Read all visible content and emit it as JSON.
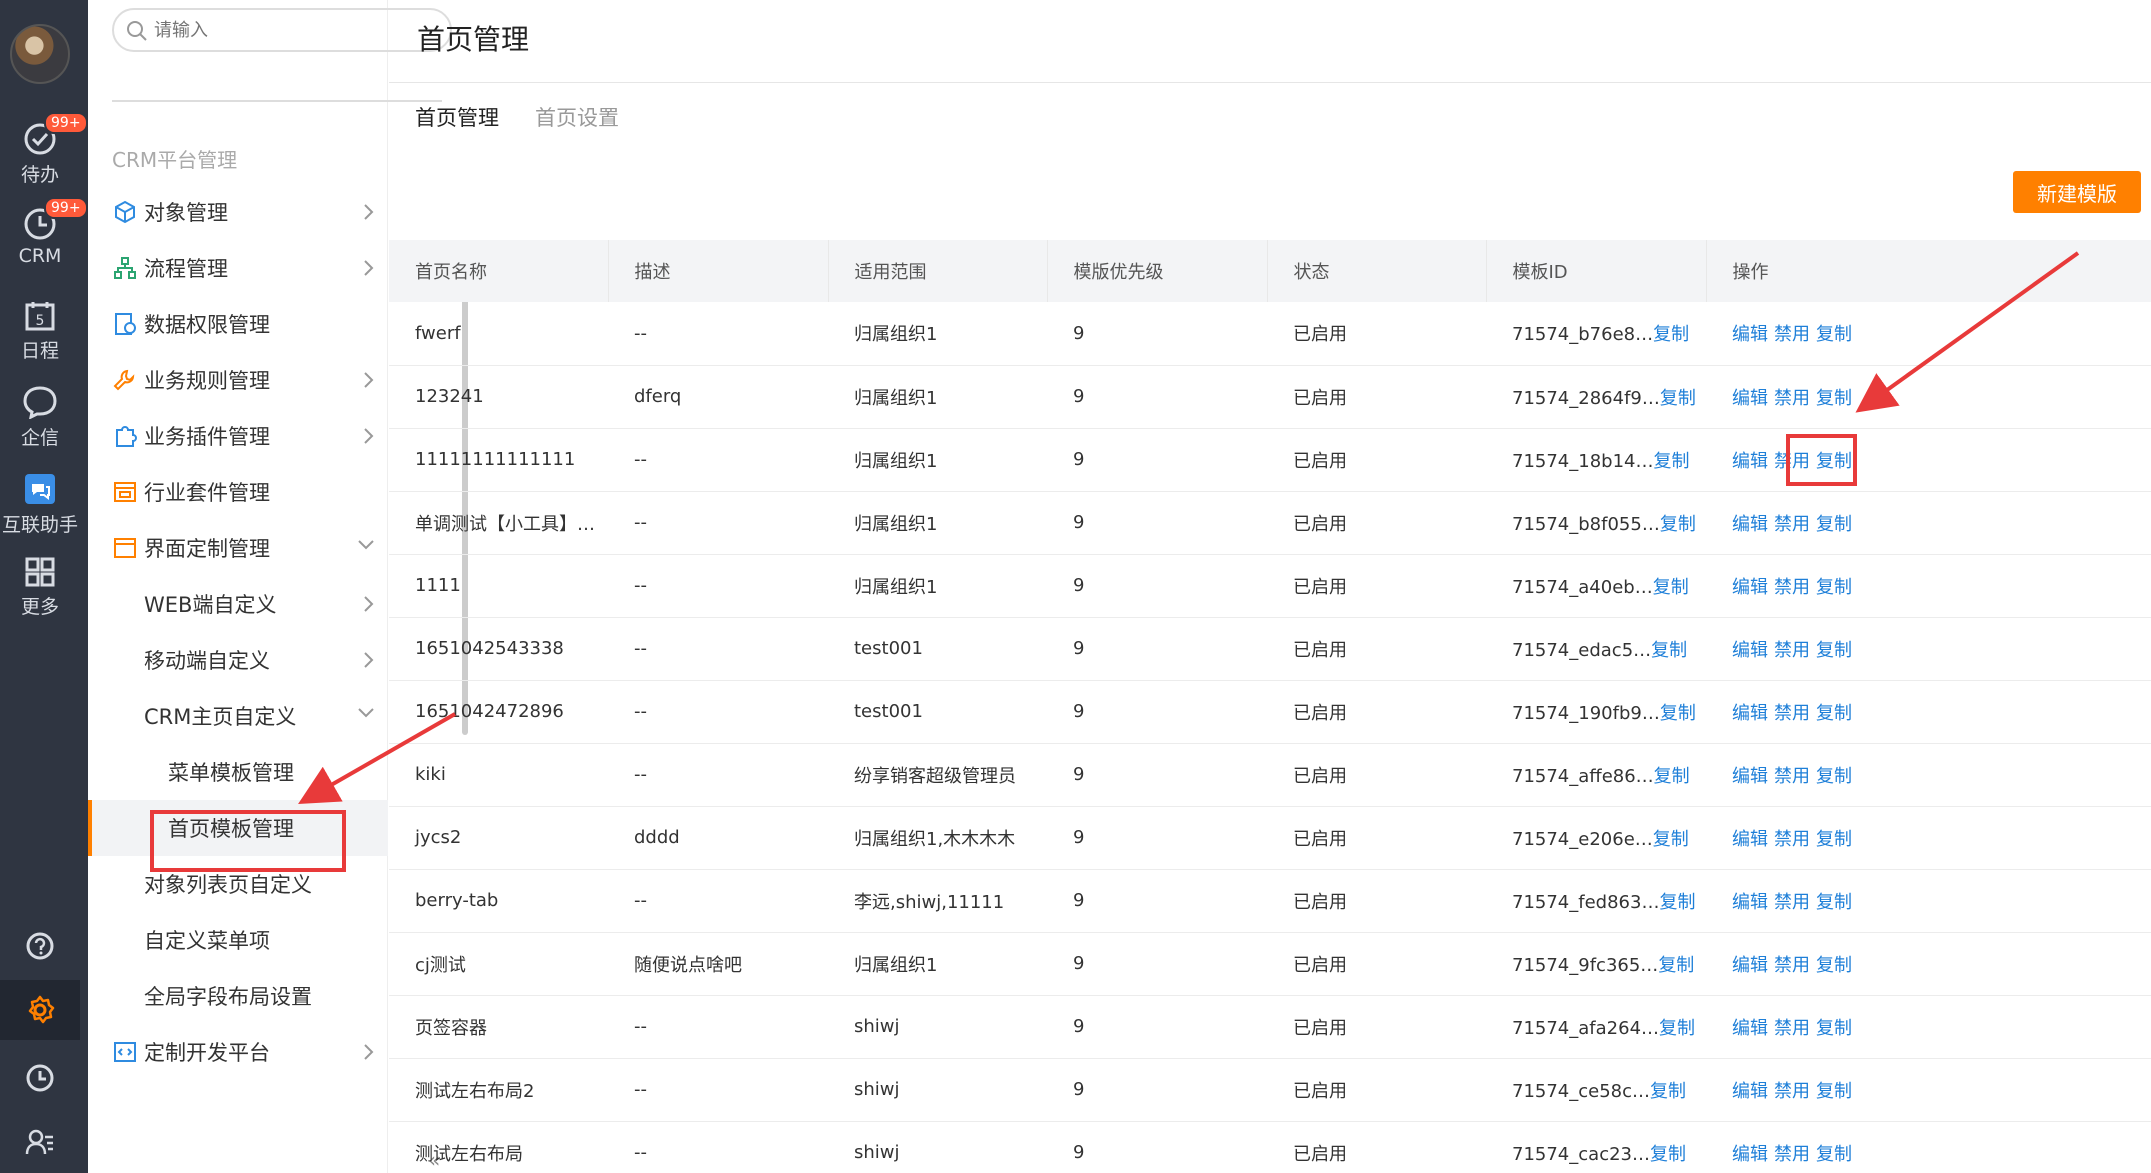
{
  "rail": {
    "items": [
      {
        "label": "待办",
        "badge": "99+",
        "icon": "check-circle-icon"
      },
      {
        "label": "CRM",
        "badge": "99+",
        "icon": "clock-circle-icon"
      },
      {
        "label": "日程",
        "icon": "calendar-icon",
        "day": "5"
      },
      {
        "label": "企信",
        "icon": "chat-bubble-icon"
      },
      {
        "label": "互联助手",
        "icon": "interconnect-icon"
      },
      {
        "label": "更多",
        "icon": "grid-icon"
      }
    ]
  },
  "sidebar": {
    "search_placeholder": "请输入",
    "section": "CRM平台管理",
    "items": [
      {
        "label": "对象管理"
      },
      {
        "label": "流程管理"
      },
      {
        "label": "数据权限管理"
      },
      {
        "label": "业务规则管理"
      },
      {
        "label": "业务插件管理"
      },
      {
        "label": "行业套件管理"
      },
      {
        "label": "界面定制管理"
      },
      {
        "label": "WEB端自定义"
      },
      {
        "label": "移动端自定义"
      },
      {
        "label": "CRM主页自定义"
      },
      {
        "label": "菜单模板管理"
      },
      {
        "label": "首页模板管理"
      },
      {
        "label": "对象列表页自定义"
      },
      {
        "label": "自定义菜单项"
      },
      {
        "label": "全局字段布局设置"
      },
      {
        "label": "定制开发平台"
      }
    ],
    "collapse": "«"
  },
  "main": {
    "title": "首页管理",
    "tabs": [
      {
        "label": "首页管理"
      },
      {
        "label": "首页设置"
      }
    ],
    "new_button": "新建模版",
    "columns": [
      "首页名称",
      "描述",
      "适用范围",
      "模版优先级",
      "状态",
      "模板ID",
      "操作"
    ],
    "copy_label": "复制",
    "ops": [
      "编辑",
      "禁用",
      "复制"
    ],
    "rows": [
      {
        "name": "fwerf",
        "desc": "--",
        "scope": "归属组织1",
        "priority": "9",
        "status": "已启用",
        "id": "71574_b76e8…"
      },
      {
        "name": "123241",
        "desc": "dferq",
        "scope": "归属组织1",
        "priority": "9",
        "status": "已启用",
        "id": "71574_2864f9…"
      },
      {
        "name": "11111111111111",
        "desc": "--",
        "scope": "归属组织1",
        "priority": "9",
        "status": "已启用",
        "id": "71574_18b14…"
      },
      {
        "name": "单调测试【小工具】…",
        "desc": "--",
        "scope": "归属组织1",
        "priority": "9",
        "status": "已启用",
        "id": "71574_b8f055…"
      },
      {
        "name": "1111",
        "desc": "--",
        "scope": "归属组织1",
        "priority": "9",
        "status": "已启用",
        "id": "71574_a40eb…"
      },
      {
        "name": "1651042543338",
        "desc": "--",
        "scope": "test001",
        "priority": "9",
        "status": "已启用",
        "id": "71574_edac5…"
      },
      {
        "name": "1651042472896",
        "desc": "--",
        "scope": "test001",
        "priority": "9",
        "status": "已启用",
        "id": "71574_190fb9…"
      },
      {
        "name": "kiki",
        "desc": "--",
        "scope": "纷享销客超级管理员",
        "priority": "9",
        "status": "已启用",
        "id": "71574_affe86…"
      },
      {
        "name": "jycs2",
        "desc": "dddd",
        "scope": "归属组织1,木木木木",
        "priority": "9",
        "status": "已启用",
        "id": "71574_e206e…"
      },
      {
        "name": "berry-tab",
        "desc": "--",
        "scope": "李远,shiwj,11111",
        "priority": "9",
        "status": "已启用",
        "id": "71574_fed863…"
      },
      {
        "name": "cj测试",
        "desc": "随便说点啥吧",
        "scope": "归属组织1",
        "priority": "9",
        "status": "已启用",
        "id": "71574_9fc365…"
      },
      {
        "name": "页签容器",
        "desc": "--",
        "scope": "shiwj",
        "priority": "9",
        "status": "已启用",
        "id": "71574_afa264…"
      },
      {
        "name": "测试左右布局2",
        "desc": "--",
        "scope": "shiwj",
        "priority": "9",
        "status": "已启用",
        "id": "71574_ce58c…"
      },
      {
        "name": "测试左右布局",
        "desc": "--",
        "scope": "shiwj",
        "priority": "9",
        "status": "已启用",
        "id": "71574_cac23…"
      }
    ]
  },
  "colors": {
    "accent": "#ff8000",
    "link": "#1e7fd8",
    "annotation": "#e83a3a",
    "rail": "#2f3541"
  }
}
